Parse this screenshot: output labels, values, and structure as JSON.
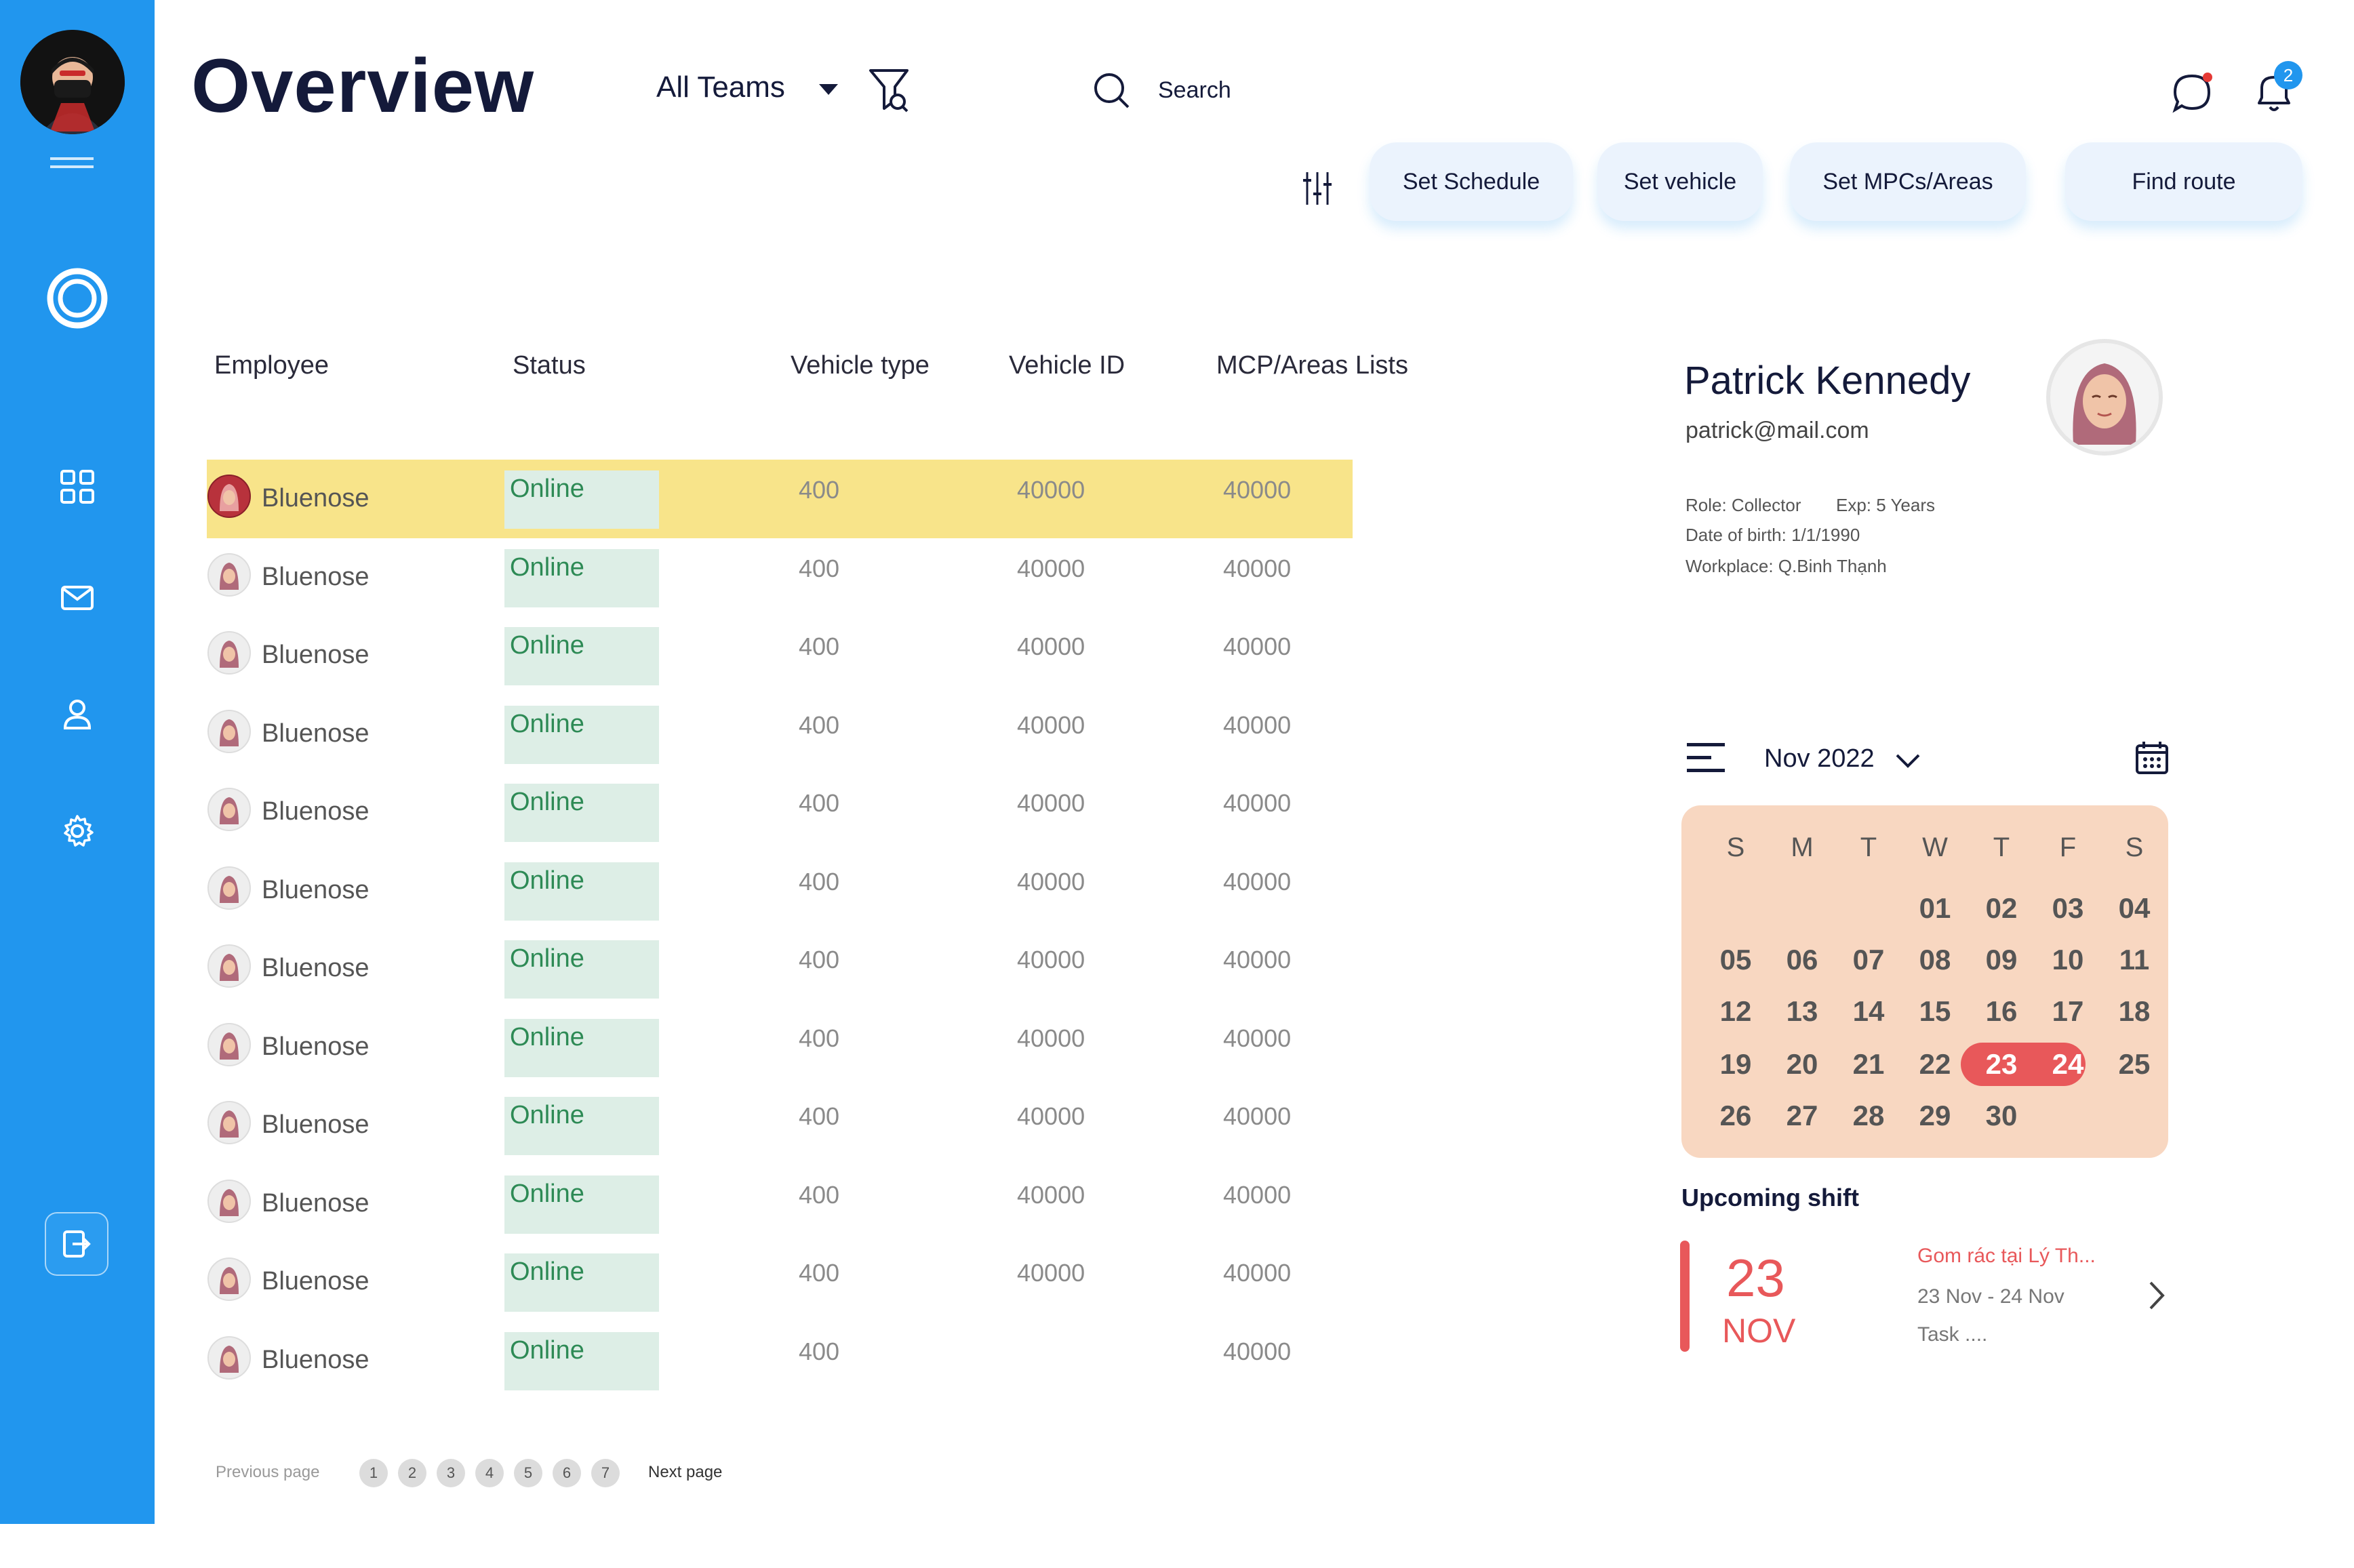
{
  "header": {
    "title": "Overview",
    "team_select": "All Teams",
    "search_label": "Search",
    "notification_count": "2",
    "accent_color": "#2196ee"
  },
  "sidebar": {
    "items": [
      {
        "icon": "dashboard-grid-icon"
      },
      {
        "icon": "mail-icon"
      },
      {
        "icon": "user-icon"
      },
      {
        "icon": "settings-gear-icon"
      }
    ],
    "logout_icon": "logout-icon"
  },
  "actions": {
    "set_schedule": "Set Schedule",
    "set_vehicle": "Set vehicle",
    "set_mpcs": "Set MPCs/Areas",
    "find_route": "Find route"
  },
  "table": {
    "columns": [
      "Employee",
      "Status",
      "Vehicle type",
      "Vehicle ID",
      "MCP/Areas Lists"
    ],
    "rows": [
      {
        "name": "Bluenose",
        "status": "Online",
        "vehicle_type": "400",
        "vehicle_id": "40000",
        "areas": "40000"
      },
      {
        "name": "Bluenose",
        "status": "Online",
        "vehicle_type": "400",
        "vehicle_id": "40000",
        "areas": "40000"
      },
      {
        "name": "Bluenose",
        "status": "Online",
        "vehicle_type": "400",
        "vehicle_id": "40000",
        "areas": "40000"
      },
      {
        "name": "Bluenose",
        "status": "Online",
        "vehicle_type": "400",
        "vehicle_id": "40000",
        "areas": "40000"
      },
      {
        "name": "Bluenose",
        "status": "Online",
        "vehicle_type": "400",
        "vehicle_id": "40000",
        "areas": "40000"
      },
      {
        "name": "Bluenose",
        "status": "Online",
        "vehicle_type": "400",
        "vehicle_id": "40000",
        "areas": "40000"
      },
      {
        "name": "Bluenose",
        "status": "Online",
        "vehicle_type": "400",
        "vehicle_id": "40000",
        "areas": "40000"
      },
      {
        "name": "Bluenose",
        "status": "Online",
        "vehicle_type": "400",
        "vehicle_id": "40000",
        "areas": "40000"
      },
      {
        "name": "Bluenose",
        "status": "Online",
        "vehicle_type": "400",
        "vehicle_id": "40000",
        "areas": "40000"
      },
      {
        "name": "Bluenose",
        "status": "Online",
        "vehicle_type": "400",
        "vehicle_id": "40000",
        "areas": "40000"
      },
      {
        "name": "Bluenose",
        "status": "Online",
        "vehicle_type": "400",
        "vehicle_id": "40000",
        "areas": "40000"
      },
      {
        "name": "Bluenose",
        "status": "Online",
        "vehicle_type": "400",
        "vehicle_id": "",
        "areas": "40000"
      }
    ],
    "selected_row": 0,
    "highlight_color": "#f8e48a"
  },
  "pagination": {
    "previous": "Previous page",
    "next": "Next page",
    "pages": [
      "1",
      "2",
      "3",
      "4",
      "5",
      "6",
      "7"
    ]
  },
  "profile": {
    "name": "Patrick Kennedy",
    "email": "patrick@mail.com",
    "role": "Role: Collector",
    "exp": "Exp: 5 Years",
    "dob": "Date of birth: 1/1/1990",
    "workplace": "Workplace: Q.Binh Thạnh"
  },
  "calendar": {
    "month": "Nov 2022",
    "weekdays": [
      "S",
      "M",
      "T",
      "W",
      "T",
      "F",
      "S"
    ],
    "days": [
      "01",
      "02",
      "03",
      "04",
      "05",
      "06",
      "07",
      "08",
      "09",
      "10",
      "11",
      "12",
      "13",
      "14",
      "15",
      "16",
      "17",
      "18",
      "19",
      "20",
      "21",
      "22",
      "23",
      "24",
      "25",
      "26",
      "27",
      "28",
      "29",
      "30"
    ],
    "first_weekday_index": 3,
    "selected_range": [
      "23",
      "24"
    ],
    "bg_color": "#f8d7c1",
    "accent_color": "#e8585a"
  },
  "upcoming": {
    "title": "Upcoming shift",
    "day": "23",
    "month": "NOV",
    "task": "Gom rác tại Lý Th...",
    "date_range": "23 Nov - 24 Nov",
    "note": "Task ...."
  }
}
